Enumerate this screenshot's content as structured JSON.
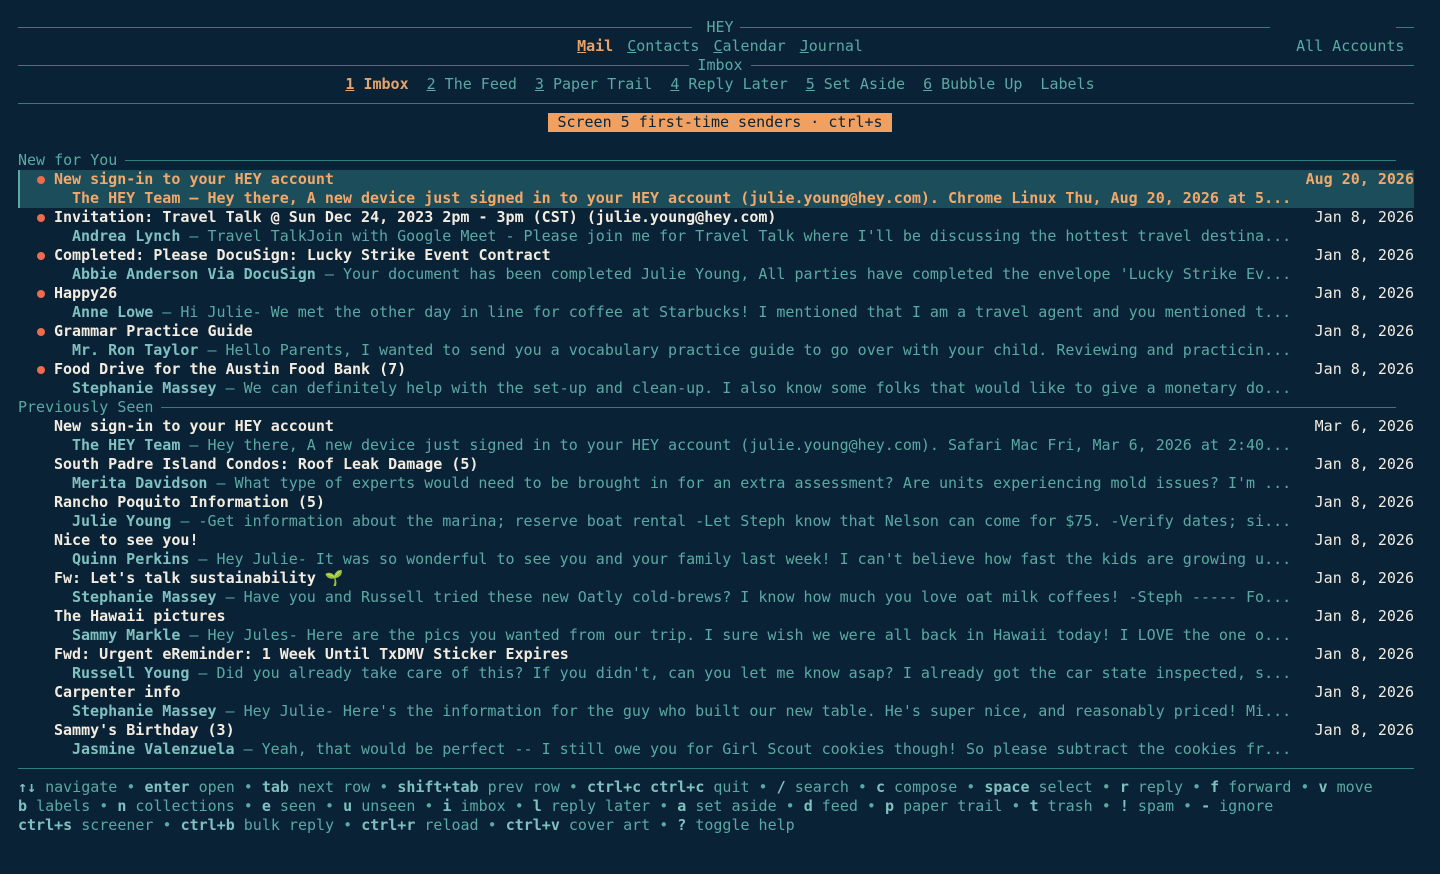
{
  "app": {
    "title": "HEY",
    "accounts_label": "All Accounts"
  },
  "main_nav": [
    {
      "key": "M",
      "rest": "ail",
      "active": true
    },
    {
      "key": "C",
      "rest": "ontacts",
      "active": false
    },
    {
      "key": "C",
      "rest": "alendar",
      "active": false
    },
    {
      "key": "J",
      "rest": "ournal",
      "active": false
    }
  ],
  "mailbox_title": "Imbox",
  "mailbox_tabs": [
    {
      "num": "1",
      "label": " Imbox",
      "active": true
    },
    {
      "num": "2",
      "label": " The Feed",
      "active": false
    },
    {
      "num": "3",
      "label": " Paper Trail",
      "active": false
    },
    {
      "num": "4",
      "label": " Reply Later",
      "active": false
    },
    {
      "num": "5",
      "label": " Set Aside",
      "active": false
    },
    {
      "num": "6",
      "label": " Bubble Up",
      "active": false
    },
    {
      "num": "",
      "label": "Labels",
      "active": false
    }
  ],
  "screener_banner": "Screen 5 first-time senders · ctrl+s",
  "sections": [
    {
      "label": "New for You",
      "emails": [
        {
          "subject": "New sign-in to your HEY account",
          "sender": "The HEY Team",
          "snippet": "Hey there, A new device just signed in to your HEY account (julie.young@hey.com). Chrome Linux Thu, Aug 20, 2026 at 5...",
          "date": "Aug 20, 2026",
          "unread": true,
          "selected": true
        },
        {
          "subject": "Invitation: Travel Talk @ Sun Dec 24, 2023 2pm - 3pm (CST) (julie.young@hey.com)",
          "sender": "Andrea Lynch",
          "snippet": "Travel TalkJoin with Google Meet - Please join me for Travel Talk where I'll be discussing the hottest travel destina...",
          "date": "Jan 8, 2026",
          "unread": true,
          "selected": false
        },
        {
          "subject": "Completed: Please DocuSign: Lucky Strike Event Contract",
          "sender": "Abbie Anderson Via DocuSign",
          "snippet": "Your document has been completed Julie Young, All parties have completed the envelope 'Lucky Strike Ev...",
          "date": "Jan 8, 2026",
          "unread": true,
          "selected": false
        },
        {
          "subject": "Happy26",
          "sender": "Anne Lowe",
          "snippet": "Hi Julie- We met the other day in line for coffee at Starbucks! I mentioned that I am a travel agent and you mentioned t...",
          "date": "Jan 8, 2026",
          "unread": true,
          "selected": false
        },
        {
          "subject": "Grammar Practice Guide",
          "sender": "Mr. Ron Taylor",
          "snippet": "Hello Parents, I wanted to send you a vocabulary practice guide to go over with your child. Reviewing and practicin...",
          "date": "Jan 8, 2026",
          "unread": true,
          "selected": false
        },
        {
          "subject": "Food Drive for the Austin Food Bank (7)",
          "sender": "Stephanie Massey",
          "snippet": "We can definitely help with the set-up and clean-up. I also know some folks that would like to give a monetary do...",
          "date": "Jan 8, 2026",
          "unread": true,
          "selected": false
        }
      ]
    },
    {
      "label": "Previously Seen",
      "emails": [
        {
          "subject": "New sign-in to your HEY account",
          "sender": "The HEY Team",
          "snippet": "Hey there, A new device just signed in to your HEY account (julie.young@hey.com). Safari Mac Fri, Mar 6, 2026 at 2:40...",
          "date": "Mar 6, 2026",
          "unread": false,
          "selected": false
        },
        {
          "subject": "South Padre Island Condos: Roof Leak Damage (5)",
          "sender": "Merita Davidson",
          "snippet": "What type of experts would need to be brought in for an extra assessment? Are units experiencing mold issues? I'm ...",
          "date": "Jan 8, 2026",
          "unread": false,
          "selected": false
        },
        {
          "subject": "Rancho Poquito Information (5)",
          "sender": "Julie Young",
          "snippet": "-Get information about the marina; reserve boat rental -Let Steph know that Nelson can come for $75. -Verify dates; si...",
          "date": "Jan 8, 2026",
          "unread": false,
          "selected": false
        },
        {
          "subject": "Nice to see you!",
          "sender": "Quinn Perkins",
          "snippet": "Hey Julie- It was so wonderful to see you and your family last week! I can't believe how fast the kids are growing u...",
          "date": "Jan 8, 2026",
          "unread": false,
          "selected": false
        },
        {
          "subject": "Fw: Let's talk sustainability 🌱",
          "sender": "Stephanie Massey",
          "snippet": "Have you and Russell tried these new Oatly cold-brews? I know how much you love oat milk coffees! -Steph ----- Fo...",
          "date": "Jan 8, 2026",
          "unread": false,
          "selected": false
        },
        {
          "subject": "The Hawaii pictures",
          "sender": "Sammy Markle",
          "snippet": "Hey Jules- Here are the pics you wanted from our trip. I sure wish we were all back in Hawaii today! I LOVE the one o...",
          "date": "Jan 8, 2026",
          "unread": false,
          "selected": false
        },
        {
          "subject": "Fwd: Urgent eReminder: 1 Week Until TxDMV Sticker Expires",
          "sender": "Russell Young",
          "snippet": "Did you already take care of this? If you didn't, can you let me know asap? I already got the car state inspected, s...",
          "date": "Jan 8, 2026",
          "unread": false,
          "selected": false
        },
        {
          "subject": "Carpenter info",
          "sender": "Stephanie Massey",
          "snippet": "Hey Julie- Here's the information for the guy who built our new table. He's super nice, and reasonably priced! Mi...",
          "date": "Jan 8, 2026",
          "unread": false,
          "selected": false
        },
        {
          "subject": "Sammy's Birthday (3)",
          "sender": "Jasmine Valenzuela",
          "snippet": "Yeah, that would be perfect -- I still owe you for Girl Scout cookies though! So please subtract the cookies fr...",
          "date": "Jan 8, 2026",
          "unread": false,
          "selected": false
        }
      ]
    }
  ],
  "help_lines": [
    [
      {
        "key": "↑↓",
        "desc": "navigate"
      },
      {
        "key": "enter",
        "desc": "open"
      },
      {
        "key": "tab",
        "desc": "next row"
      },
      {
        "key": "shift+tab",
        "desc": "prev row"
      },
      {
        "key": "ctrl+c ctrl+c",
        "desc": "quit"
      },
      {
        "key": "/",
        "desc": "search"
      },
      {
        "key": "c",
        "desc": "compose"
      },
      {
        "key": "space",
        "desc": "select"
      },
      {
        "key": "r",
        "desc": "reply"
      },
      {
        "key": "f",
        "desc": "forward"
      },
      {
        "key": "v",
        "desc": "move"
      }
    ],
    [
      {
        "key": "b",
        "desc": "labels"
      },
      {
        "key": "n",
        "desc": "collections"
      },
      {
        "key": "e",
        "desc": "seen"
      },
      {
        "key": "u",
        "desc": "unseen"
      },
      {
        "key": "i",
        "desc": "imbox"
      },
      {
        "key": "l",
        "desc": "reply later"
      },
      {
        "key": "a",
        "desc": "set aside"
      },
      {
        "key": "d",
        "desc": "feed"
      },
      {
        "key": "p",
        "desc": "paper trail"
      },
      {
        "key": "t",
        "desc": "trash"
      },
      {
        "key": "!",
        "desc": "spam"
      },
      {
        "key": "-",
        "desc": "ignore"
      }
    ],
    [
      {
        "key": "ctrl+s",
        "desc": "screener"
      },
      {
        "key": "ctrl+b",
        "desc": "bulk reply"
      },
      {
        "key": "ctrl+r",
        "desc": "reload"
      },
      {
        "key": "ctrl+v",
        "desc": "cover art"
      },
      {
        "key": "?",
        "desc": "toggle help"
      }
    ]
  ]
}
